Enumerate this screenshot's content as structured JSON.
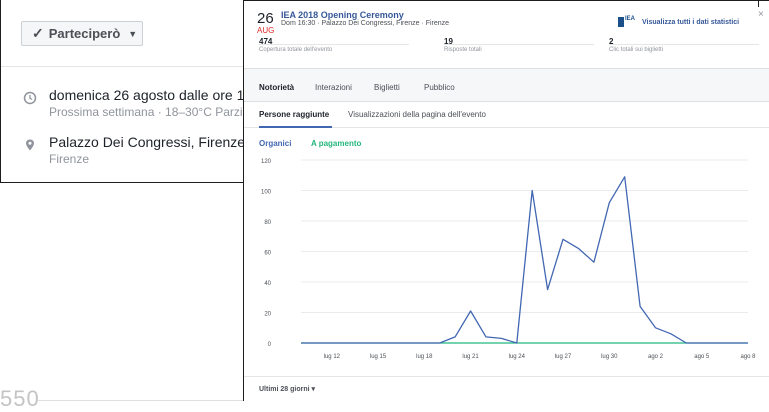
{
  "background": {
    "rsvp_label": "Parteciperò",
    "date_text": "domenica 26 agosto dalle ore 1",
    "date_sub": "Prossima settimana · 18–30°C Parzi",
    "place_text": "Palazzo Dei Congressi, Firenze",
    "place_sub": "Firenze",
    "watermark": "550",
    "icons": [
      "check-icon",
      "caret-down-icon",
      "clock-icon",
      "map-pin-icon"
    ]
  },
  "event": {
    "day": "26",
    "month": "AUG",
    "title": "IEA 2018 Opening Ceremony",
    "subtitle": "Dom 16:30 · Palazzo Dei Congressi, Firenze · Firenze",
    "view_all_stats": "Visualizza tutti i dati statistici",
    "logo_text": "IEA",
    "close_glyph": "×"
  },
  "metrics": [
    {
      "value": "474",
      "label": "Copertura totale dell'evento"
    },
    {
      "value": "19",
      "label": "Risposte totali"
    },
    {
      "value": "2",
      "label": "Clic totali sui biglietti"
    }
  ],
  "tabs": [
    "Notorietà",
    "Interazioni",
    "Biglietti",
    "Pubblico"
  ],
  "active_tab": "Notorietà",
  "subtabs": [
    "Persone raggiunte",
    "Visualizzazioni della pagina dell'evento"
  ],
  "legend": {
    "organic": "Organici",
    "paid": "A pagamento"
  },
  "colors": {
    "organic": "#4267b2",
    "paid": "#23b67f",
    "link": "#365899",
    "month": "#e02828"
  },
  "range_label": "Ultimi 28 giorni",
  "range_caret": "▾",
  "chart_data": {
    "type": "line",
    "x": [
      "lug 10",
      "lug 11",
      "lug 12",
      "lug 13",
      "lug 14",
      "lug 15",
      "lug 16",
      "lug 17",
      "lug 18",
      "lug 19",
      "lug 20",
      "lug 21",
      "lug 22",
      "lug 23",
      "lug 24",
      "lug 25",
      "lug 26",
      "lug 27",
      "lug 28",
      "lug 29",
      "lug 30",
      "lug 31",
      "ago 1",
      "ago 2",
      "ago 3",
      "ago 4",
      "ago 5",
      "ago 6",
      "ago 7",
      "ago 8"
    ],
    "x_tick_labels": [
      "lug 12",
      "lug 15",
      "lug 18",
      "lug 21",
      "lug 24",
      "lug 27",
      "lug 30",
      "ago 2",
      "ago 5",
      "ago 8"
    ],
    "series": [
      {
        "name": "Organici",
        "values": [
          0,
          0,
          0,
          0,
          0,
          0,
          0,
          0,
          0,
          0,
          4,
          21,
          4,
          3,
          0,
          100,
          35,
          68,
          62,
          53,
          92,
          109,
          24,
          10,
          6,
          0,
          0,
          0,
          0,
          0
        ]
      },
      {
        "name": "A pagamento",
        "values": [
          0,
          0,
          0,
          0,
          0,
          0,
          0,
          0,
          0,
          0,
          0,
          0,
          0,
          0,
          0,
          0,
          0,
          0,
          0,
          0,
          0,
          0,
          0,
          0,
          0,
          0,
          0,
          0,
          0,
          0
        ]
      }
    ],
    "yticks": [
      0,
      20,
      40,
      60,
      80,
      100,
      120
    ],
    "ylim": [
      0,
      120
    ],
    "grid": true,
    "legend_position": "top-left"
  }
}
